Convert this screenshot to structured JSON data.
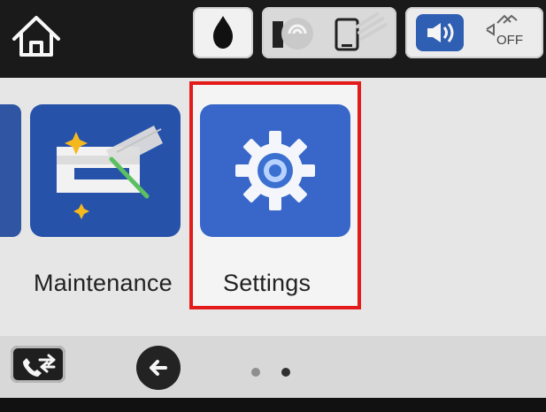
{
  "header": {
    "home_icon": "home-icon",
    "ink_icon": "ink-drop-icon",
    "device_icons": [
      "printer-status-icon",
      "mobile-connection-icon"
    ],
    "sound_icon": "sound-icon",
    "power_icon": "off-icon"
  },
  "menu": {
    "items": [
      {
        "label": "Maintenance",
        "icon": "maintenance-icon"
      },
      {
        "label": "Settings",
        "icon": "gear-icon",
        "selected": true
      }
    ]
  },
  "footer": {
    "phone_icon": "phone-transfer-icon",
    "back_icon": "back-arrow-icon",
    "page_dots": 2
  },
  "colors": {
    "accent": "#e41b1b",
    "tile_blue": "#3867c9",
    "dark_tile_blue": "#2652aa"
  }
}
